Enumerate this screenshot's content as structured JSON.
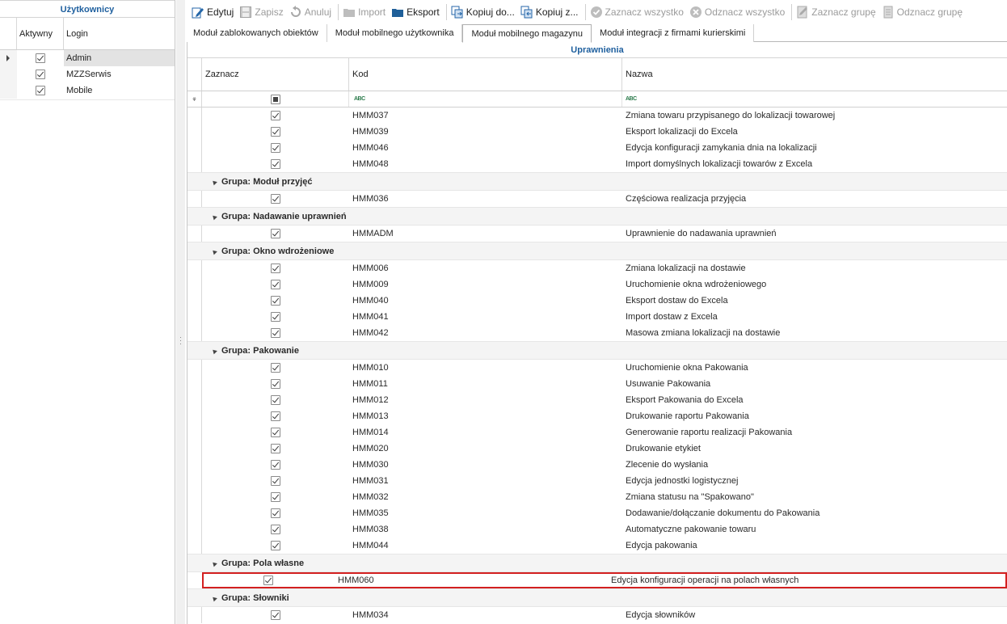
{
  "left": {
    "title": "Użytkownicy",
    "col_active": "Aktywny",
    "col_login": "Login",
    "rows": [
      {
        "login": "Admin",
        "active": true,
        "selected": true
      },
      {
        "login": "MZZSerwis",
        "active": true,
        "selected": false
      },
      {
        "login": "Mobile",
        "active": true,
        "selected": false
      }
    ]
  },
  "toolbar": {
    "edit": "Edytuj",
    "save": "Zapisz",
    "cancel": "Anuluj",
    "import": "Import",
    "export": "Eksport",
    "copy1": "Kopiuj do...",
    "copy2": "Kopiuj z...",
    "select_all": "Zaznacz wszystko",
    "deselect_all": "Odznacz wszystko",
    "select_group": "Zaznacz grupę",
    "deselect_group": "Odznacz grupę"
  },
  "tabs": [
    {
      "label": "Moduł zablokowanych obiektów",
      "active": false
    },
    {
      "label": "Moduł mobilnego użytkownika",
      "active": false
    },
    {
      "label": "Moduł mobilnego magazynu",
      "active": true
    },
    {
      "label": "Moduł integracji z firmami kurierskimi",
      "active": false
    }
  ],
  "grid": {
    "title": "Uprawnienia",
    "col_select": "Zaznacz",
    "col_code": "Kod",
    "col_name": "Nazwa",
    "filter_text_icon": "abc-filter-icon"
  },
  "rows": [
    {
      "type": "row",
      "code": "HMM037",
      "name": "Zmiana towaru przypisanego do lokalizacji towarowej"
    },
    {
      "type": "row",
      "code": "HMM039",
      "name": "Eksport lokalizacji do Excela"
    },
    {
      "type": "row",
      "code": "HMM046",
      "name": "Edycja konfiguracji zamykania dnia na lokalizacji"
    },
    {
      "type": "row",
      "code": "HMM048",
      "name": "Import domyślnych lokalizacji towarów z Excela"
    },
    {
      "type": "group",
      "label": "Grupa: Moduł przyjęć"
    },
    {
      "type": "row",
      "code": "HMM036",
      "name": "Częściowa realizacja przyjęcia"
    },
    {
      "type": "group",
      "label": "Grupa: Nadawanie uprawnień"
    },
    {
      "type": "row",
      "code": "HMMADM",
      "name": "Uprawnienie do nadawania uprawnień"
    },
    {
      "type": "group",
      "label": "Grupa: Okno wdrożeniowe"
    },
    {
      "type": "row",
      "code": "HMM006",
      "name": "Zmiana lokalizacji na dostawie"
    },
    {
      "type": "row",
      "code": "HMM009",
      "name": "Uruchomienie okna wdrożeniowego"
    },
    {
      "type": "row",
      "code": "HMM040",
      "name": "Eksport dostaw do Excela"
    },
    {
      "type": "row",
      "code": "HMM041",
      "name": "Import dostaw z Excela"
    },
    {
      "type": "row",
      "code": "HMM042",
      "name": "Masowa zmiana lokalizacji na dostawie"
    },
    {
      "type": "group",
      "label": "Grupa: Pakowanie"
    },
    {
      "type": "row",
      "code": "HMM010",
      "name": "Uruchomienie okna Pakowania"
    },
    {
      "type": "row",
      "code": "HMM011",
      "name": "Usuwanie Pakowania"
    },
    {
      "type": "row",
      "code": "HMM012",
      "name": "Eksport Pakowania do Excela"
    },
    {
      "type": "row",
      "code": "HMM013",
      "name": "Drukowanie raportu Pakowania"
    },
    {
      "type": "row",
      "code": "HMM014",
      "name": "Generowanie raportu realizacji Pakowania"
    },
    {
      "type": "row",
      "code": "HMM020",
      "name": "Drukowanie etykiet"
    },
    {
      "type": "row",
      "code": "HMM030",
      "name": "Zlecenie do wysłania"
    },
    {
      "type": "row",
      "code": "HMM031",
      "name": "Edycja jednostki logistycznej"
    },
    {
      "type": "row",
      "code": "HMM032",
      "name": "Zmiana statusu na \"Spakowano\""
    },
    {
      "type": "row",
      "code": "HMM035",
      "name": "Dodawanie/dołączanie dokumentu do Pakowania"
    },
    {
      "type": "row",
      "code": "HMM038",
      "name": "Automatyczne pakowanie towaru"
    },
    {
      "type": "row",
      "code": "HMM044",
      "name": "Edycja pakowania"
    },
    {
      "type": "group",
      "label": "Grupa: Pola własne"
    },
    {
      "type": "row",
      "code": "HMM060",
      "name": "Edycja konfiguracji operacji na polach własnych",
      "highlight": true
    },
    {
      "type": "group",
      "label": "Grupa: Słowniki"
    },
    {
      "type": "row",
      "code": "HMM034",
      "name": "Edycja słowników"
    }
  ]
}
